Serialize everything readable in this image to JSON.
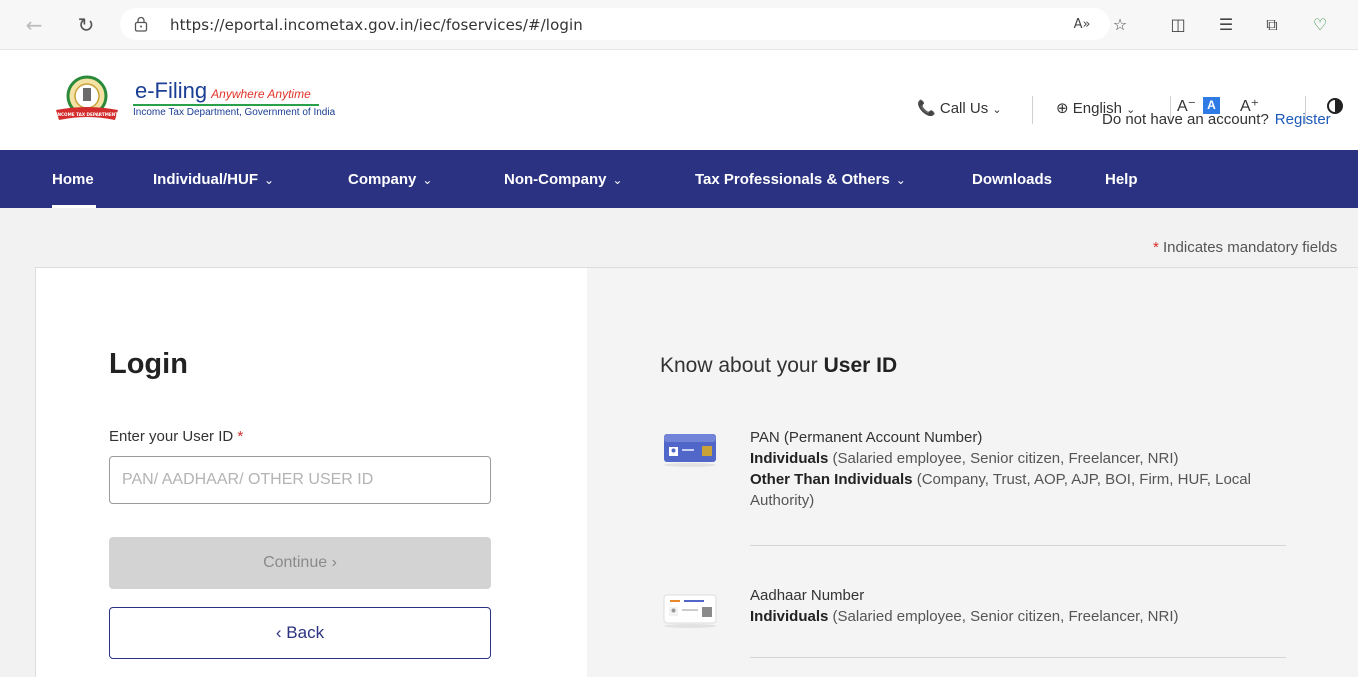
{
  "browser": {
    "url": "https://eportal.incometax.gov.in/iec/foservices/#/login"
  },
  "header": {
    "logo_title": "e-Filing",
    "logo_tagline": "Anywhere Anytime",
    "logo_subtitle": "Income Tax Department, Government of India",
    "emblem_ribbon_text": "INCOME TAX DEPARTMENT",
    "call_us": "Call Us",
    "language": "English",
    "font_decrease": "A⁻",
    "font_normal": "A",
    "font_increase": "A⁺",
    "no_account_text": "Do not have an account?",
    "register_link": "Register"
  },
  "nav": {
    "items": [
      {
        "label": "Home"
      },
      {
        "label": "Individual/HUF"
      },
      {
        "label": "Company"
      },
      {
        "label": "Non-Company"
      },
      {
        "label": "Tax Professionals & Others"
      },
      {
        "label": "Downloads"
      },
      {
        "label": "Help"
      }
    ]
  },
  "page": {
    "mandatory_star": "*",
    "mandatory_note": "Indicates mandatory fields"
  },
  "login": {
    "title": "Login",
    "field_label": "Enter your User ID",
    "required_star": "*",
    "input_value": "",
    "input_placeholder": "PAN/ AADHAAR/ OTHER USER ID",
    "continue_label": "Continue",
    "back_label": "Back"
  },
  "know": {
    "title_prefix": "Know about your",
    "title_bold": "User ID",
    "items": [
      {
        "heading": "PAN (Permanent Account Number)",
        "line1_bold": "Individuals",
        "line1_rest": "(Salaried employee, Senior citizen, Freelancer, NRI)",
        "line2_bold": "Other Than Individuals",
        "line2_rest": "(Company, Trust, AOP, AJP, BOI, Firm, HUF, Local Authority)"
      },
      {
        "heading": "Aadhaar Number",
        "line1_bold": "Individuals",
        "line1_rest": "(Salaried employee, Senior citizen, Freelancer, NRI)"
      }
    ]
  },
  "colors": {
    "nav_bg": "#2a3281",
    "link_blue": "#1d5ab8",
    "required_red": "#d62c2c"
  }
}
